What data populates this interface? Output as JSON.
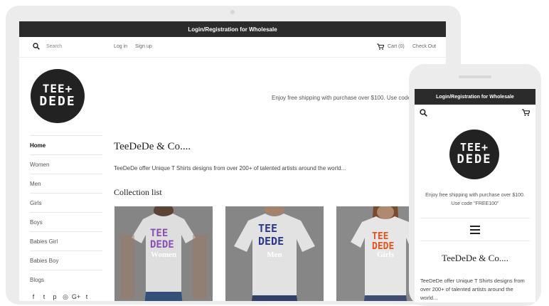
{
  "wholesale": {
    "label": "Login/Registration for Wholesale"
  },
  "topnav": {
    "search_placeholder": "Search",
    "login": "Log in",
    "signup": "Sign up",
    "cart": "Cart (0)",
    "checkout": "Check Out"
  },
  "logo": {
    "line1": "TEE+",
    "line2": "DEDE"
  },
  "shipping_notice": "Enjoy free shipping with purchase over $100. Use code",
  "sidebar": {
    "items": [
      {
        "label": "Home"
      },
      {
        "label": "Women"
      },
      {
        "label": "Men"
      },
      {
        "label": "Girls"
      },
      {
        "label": "Boys"
      },
      {
        "label": "Babies Girl"
      },
      {
        "label": "Babies Boy"
      },
      {
        "label": "Blogs"
      }
    ],
    "socials": [
      {
        "icon": "facebook-icon",
        "glyph": "f"
      },
      {
        "icon": "twitter-icon",
        "glyph": "t"
      },
      {
        "icon": "pinterest-icon",
        "glyph": "p"
      },
      {
        "icon": "instagram-icon",
        "glyph": "◎"
      },
      {
        "icon": "google-plus-icon",
        "glyph": "G+"
      },
      {
        "icon": "tumblr-icon",
        "glyph": "t"
      }
    ]
  },
  "main": {
    "title": "TeeDeDe & Co....",
    "description": "TeeDeDe offer Unique T Shirts designs from over 200+ of talented artists around the world...",
    "collection_title": "Collection list",
    "collections": [
      {
        "label": "Women"
      },
      {
        "label": "Men"
      },
      {
        "label": "Girls"
      }
    ]
  },
  "phone": {
    "wholesale": "Login/Registration for Wholesale",
    "shipping_line1": "Enjoy free shipping with purchase over $100.",
    "shipping_line2": "Use code \"FREE100\"",
    "title": "TeeDeDe & Co....",
    "description": "TeeDeDe offer Unique T Shirts designs from over 200+ of talented artists around the world..."
  },
  "colors": {
    "bar": "#2b2b2b",
    "device": "#ececec",
    "women_print": "#8a4fb4",
    "men_print": "#2d3a8c",
    "girls_print": "#e0561e"
  }
}
